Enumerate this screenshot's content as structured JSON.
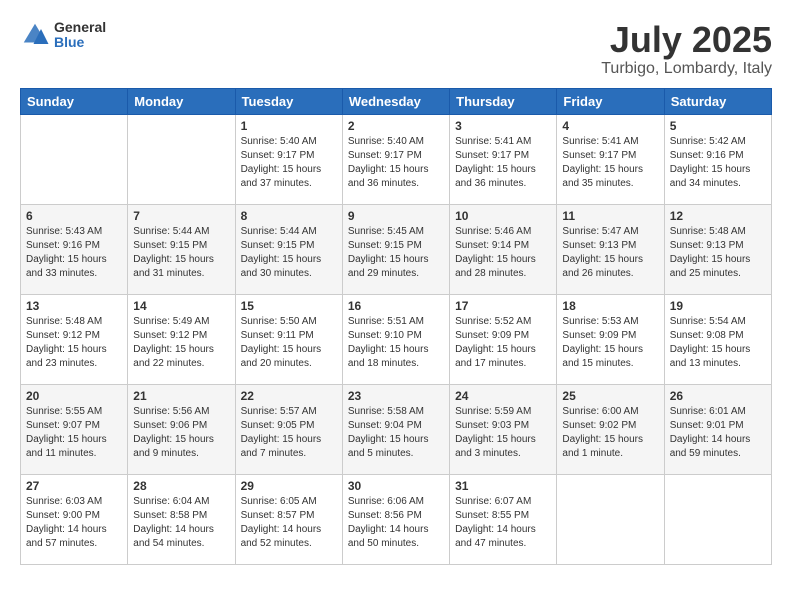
{
  "logo": {
    "general": "General",
    "blue": "Blue"
  },
  "title": "July 2025",
  "location": "Turbigo, Lombardy, Italy",
  "weekdays": [
    "Sunday",
    "Monday",
    "Tuesday",
    "Wednesday",
    "Thursday",
    "Friday",
    "Saturday"
  ],
  "weeks": [
    [
      {
        "day": "",
        "detail": ""
      },
      {
        "day": "",
        "detail": ""
      },
      {
        "day": "1",
        "detail": "Sunrise: 5:40 AM\nSunset: 9:17 PM\nDaylight: 15 hours\nand 37 minutes."
      },
      {
        "day": "2",
        "detail": "Sunrise: 5:40 AM\nSunset: 9:17 PM\nDaylight: 15 hours\nand 36 minutes."
      },
      {
        "day": "3",
        "detail": "Sunrise: 5:41 AM\nSunset: 9:17 PM\nDaylight: 15 hours\nand 36 minutes."
      },
      {
        "day": "4",
        "detail": "Sunrise: 5:41 AM\nSunset: 9:17 PM\nDaylight: 15 hours\nand 35 minutes."
      },
      {
        "day": "5",
        "detail": "Sunrise: 5:42 AM\nSunset: 9:16 PM\nDaylight: 15 hours\nand 34 minutes."
      }
    ],
    [
      {
        "day": "6",
        "detail": "Sunrise: 5:43 AM\nSunset: 9:16 PM\nDaylight: 15 hours\nand 33 minutes."
      },
      {
        "day": "7",
        "detail": "Sunrise: 5:44 AM\nSunset: 9:15 PM\nDaylight: 15 hours\nand 31 minutes."
      },
      {
        "day": "8",
        "detail": "Sunrise: 5:44 AM\nSunset: 9:15 PM\nDaylight: 15 hours\nand 30 minutes."
      },
      {
        "day": "9",
        "detail": "Sunrise: 5:45 AM\nSunset: 9:15 PM\nDaylight: 15 hours\nand 29 minutes."
      },
      {
        "day": "10",
        "detail": "Sunrise: 5:46 AM\nSunset: 9:14 PM\nDaylight: 15 hours\nand 28 minutes."
      },
      {
        "day": "11",
        "detail": "Sunrise: 5:47 AM\nSunset: 9:13 PM\nDaylight: 15 hours\nand 26 minutes."
      },
      {
        "day": "12",
        "detail": "Sunrise: 5:48 AM\nSunset: 9:13 PM\nDaylight: 15 hours\nand 25 minutes."
      }
    ],
    [
      {
        "day": "13",
        "detail": "Sunrise: 5:48 AM\nSunset: 9:12 PM\nDaylight: 15 hours\nand 23 minutes."
      },
      {
        "day": "14",
        "detail": "Sunrise: 5:49 AM\nSunset: 9:12 PM\nDaylight: 15 hours\nand 22 minutes."
      },
      {
        "day": "15",
        "detail": "Sunrise: 5:50 AM\nSunset: 9:11 PM\nDaylight: 15 hours\nand 20 minutes."
      },
      {
        "day": "16",
        "detail": "Sunrise: 5:51 AM\nSunset: 9:10 PM\nDaylight: 15 hours\nand 18 minutes."
      },
      {
        "day": "17",
        "detail": "Sunrise: 5:52 AM\nSunset: 9:09 PM\nDaylight: 15 hours\nand 17 minutes."
      },
      {
        "day": "18",
        "detail": "Sunrise: 5:53 AM\nSunset: 9:09 PM\nDaylight: 15 hours\nand 15 minutes."
      },
      {
        "day": "19",
        "detail": "Sunrise: 5:54 AM\nSunset: 9:08 PM\nDaylight: 15 hours\nand 13 minutes."
      }
    ],
    [
      {
        "day": "20",
        "detail": "Sunrise: 5:55 AM\nSunset: 9:07 PM\nDaylight: 15 hours\nand 11 minutes."
      },
      {
        "day": "21",
        "detail": "Sunrise: 5:56 AM\nSunset: 9:06 PM\nDaylight: 15 hours\nand 9 minutes."
      },
      {
        "day": "22",
        "detail": "Sunrise: 5:57 AM\nSunset: 9:05 PM\nDaylight: 15 hours\nand 7 minutes."
      },
      {
        "day": "23",
        "detail": "Sunrise: 5:58 AM\nSunset: 9:04 PM\nDaylight: 15 hours\nand 5 minutes."
      },
      {
        "day": "24",
        "detail": "Sunrise: 5:59 AM\nSunset: 9:03 PM\nDaylight: 15 hours\nand 3 minutes."
      },
      {
        "day": "25",
        "detail": "Sunrise: 6:00 AM\nSunset: 9:02 PM\nDaylight: 15 hours\nand 1 minute."
      },
      {
        "day": "26",
        "detail": "Sunrise: 6:01 AM\nSunset: 9:01 PM\nDaylight: 14 hours\nand 59 minutes."
      }
    ],
    [
      {
        "day": "27",
        "detail": "Sunrise: 6:03 AM\nSunset: 9:00 PM\nDaylight: 14 hours\nand 57 minutes."
      },
      {
        "day": "28",
        "detail": "Sunrise: 6:04 AM\nSunset: 8:58 PM\nDaylight: 14 hours\nand 54 minutes."
      },
      {
        "day": "29",
        "detail": "Sunrise: 6:05 AM\nSunset: 8:57 PM\nDaylight: 14 hours\nand 52 minutes."
      },
      {
        "day": "30",
        "detail": "Sunrise: 6:06 AM\nSunset: 8:56 PM\nDaylight: 14 hours\nand 50 minutes."
      },
      {
        "day": "31",
        "detail": "Sunrise: 6:07 AM\nSunset: 8:55 PM\nDaylight: 14 hours\nand 47 minutes."
      },
      {
        "day": "",
        "detail": ""
      },
      {
        "day": "",
        "detail": ""
      }
    ]
  ]
}
